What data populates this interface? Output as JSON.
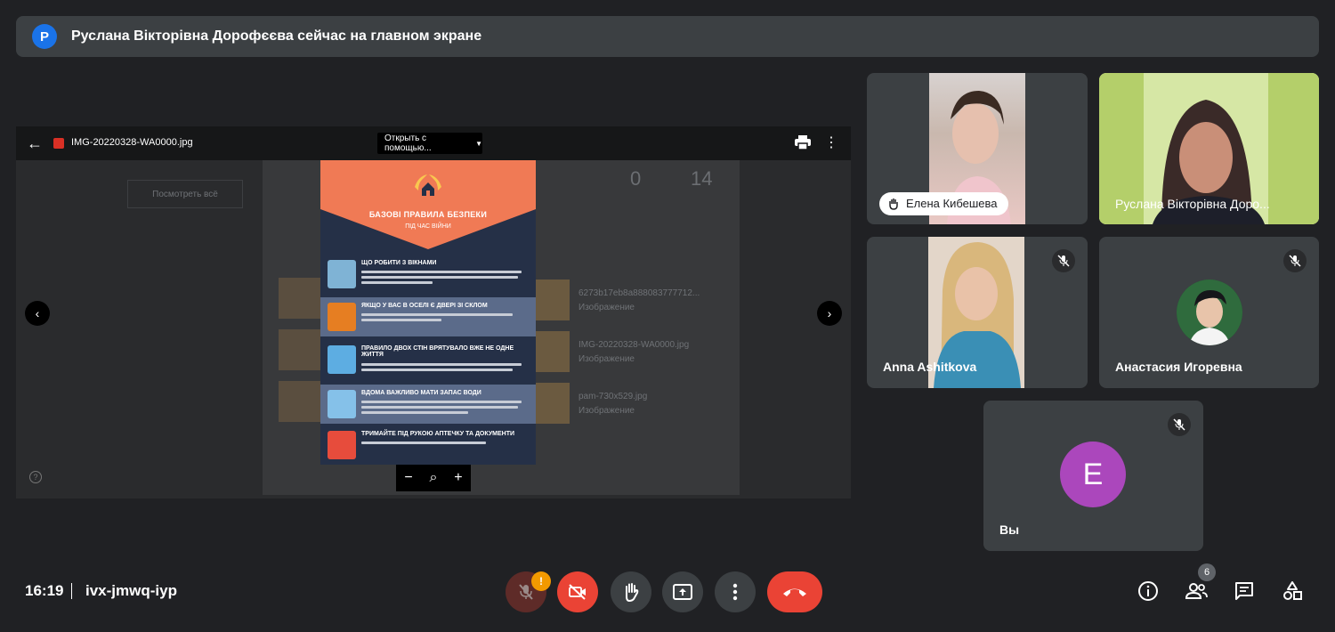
{
  "banner": {
    "avatar_letter": "Р",
    "text": "Руслана Вікторівна Дорофєєва сейчас на главном экране"
  },
  "viewer": {
    "filename": "IMG-20220328-WA0000.jpg",
    "open_with": "Открыть с помощью...",
    "background": {
      "stat_a": "0",
      "stat_b": "14",
      "view_all": "Посмотреть всё",
      "files": [
        {
          "name": "6273b17eb8a888083777712...",
          "type": "Изображение"
        },
        {
          "name": "IMG-20220328-WA0000.jpg",
          "type": "Изображение"
        },
        {
          "name": "pam-730x529.jpg",
          "type": "Изображение"
        }
      ]
    }
  },
  "poster": {
    "title": "БАЗОВІ ПРАВИЛА БЕЗПЕКИ",
    "subtitle": "ПІД ЧАС ВІЙНИ",
    "sections": [
      {
        "title": "ЩО РОБИТИ З ВІКНАМИ",
        "color": "#7fb3d5"
      },
      {
        "title": "ЯКЩО У ВАС В ОСЕЛІ Є ДВЕРІ ЗІ СКЛОМ",
        "color": "#e67e22"
      },
      {
        "title": "ПРАВИЛО ДВОХ СТІН ВРЯТУВАЛО ВЖЕ НЕ ОДНЕ ЖИТТЯ",
        "color": "#5dade2"
      },
      {
        "title": "ВДОМА ВАЖЛИВО МАТИ ЗАПАС ВОДИ",
        "color": "#85c1e9"
      },
      {
        "title": "ТРИМАЙТЕ ПІД РУКОЮ АПТЕЧКУ ТА ДОКУМЕНТИ",
        "color": "#e74c3c"
      }
    ]
  },
  "participants": [
    {
      "name": "Елена Кибешева",
      "muted": false
    },
    {
      "name": "Руслана Вікторівна Доро...",
      "muted": false
    },
    {
      "name": "Anna Ashitkova",
      "muted": true
    },
    {
      "name": "Анастасия Игоревна",
      "muted": true
    },
    {
      "name": "Вы",
      "avatar_letter": "E",
      "avatar_color": "#ab47bc",
      "muted": true
    }
  ],
  "bottom": {
    "time": "16:19",
    "meeting_code": "ivx-jmwq-iyp",
    "mic_alert": "!",
    "people_count": "6"
  },
  "colors": {
    "background": "#202124",
    "tile": "#3c4043",
    "red": "#ea4335"
  }
}
